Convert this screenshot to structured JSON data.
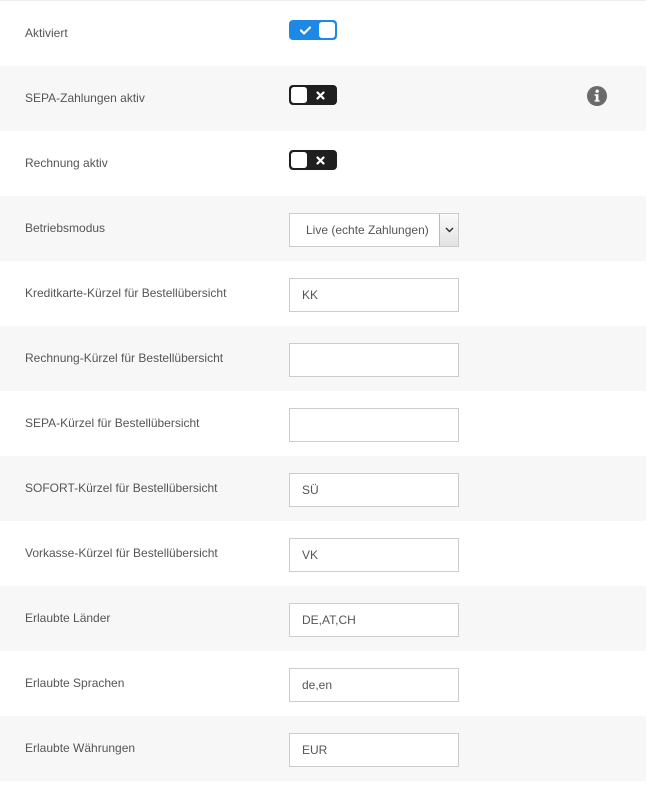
{
  "colors": {
    "accent": "#1e88e5",
    "toggle_off": "#1f1f1f",
    "row_alt": "#f7f7f7",
    "info_icon": "#6b6b6b"
  },
  "settings": {
    "activated": {
      "label": "Aktiviert",
      "state": "on"
    },
    "sepa_payments": {
      "label": "SEPA-Zahlungen aktiv",
      "state": "off",
      "info_icon": "info-icon"
    },
    "invoice": {
      "label": "Rechnung aktiv",
      "state": "off"
    },
    "mode": {
      "label": "Betriebsmodus",
      "value": "Live (echte Zahlungen)"
    },
    "cc_short": {
      "label": "Kreditkarte-Kürzel für Bestellübersicht",
      "value": "KK"
    },
    "invoice_short": {
      "label": "Rechnung-Kürzel für Bestellübersicht",
      "value": ""
    },
    "sepa_short": {
      "label": "SEPA-Kürzel für Bestellübersicht",
      "value": ""
    },
    "sofort_short": {
      "label": "SOFORT-Kürzel für Bestellübersicht",
      "value": "SÜ"
    },
    "prepay_short": {
      "label": "Vorkasse-Kürzel für Bestellübersicht",
      "value": "VK"
    },
    "countries": {
      "label": "Erlaubte Länder",
      "value": "DE,AT,CH"
    },
    "languages": {
      "label": "Erlaubte Sprachen",
      "value": "de,en"
    },
    "currencies": {
      "label": "Erlaubte Währungen",
      "value": "EUR"
    }
  }
}
